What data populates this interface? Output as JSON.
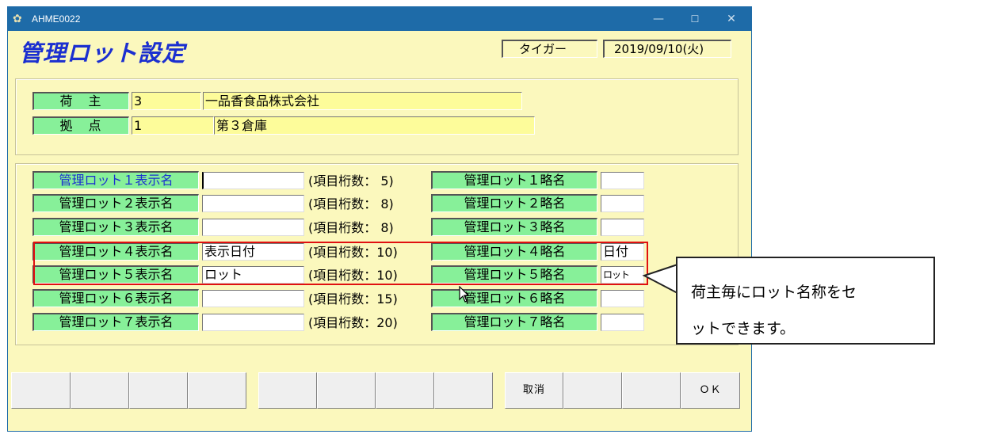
{
  "window": {
    "title": "AHME0022",
    "icon": "app-icon",
    "controls": {
      "minimize": "—",
      "maximize": "☐",
      "close": "✕"
    }
  },
  "header": {
    "page_title": "管理ロット設定",
    "user": "タイガー",
    "date": "2019/09/10(火)"
  },
  "shipper": {
    "label": "荷　主",
    "code": "3",
    "name": "一品香食品株式会社"
  },
  "base": {
    "label": "拠　点",
    "code": "1",
    "name": "第３倉庫"
  },
  "lots": [
    {
      "display_label": "管理ロット１表示名",
      "display_value": "",
      "digits": "(項目桁数： 5)",
      "short_label": "管理ロット１略名",
      "short_value": ""
    },
    {
      "display_label": "管理ロット２表示名",
      "display_value": "",
      "digits": "(項目桁数： 8)",
      "short_label": "管理ロット２略名",
      "short_value": ""
    },
    {
      "display_label": "管理ロット３表示名",
      "display_value": "",
      "digits": "(項目桁数： 8)",
      "short_label": "管理ロット３略名",
      "short_value": ""
    },
    {
      "display_label": "管理ロット４表示名",
      "display_value": "表示日付",
      "digits": "(項目桁数：10)",
      "short_label": "管理ロット４略名",
      "short_value": "日付"
    },
    {
      "display_label": "管理ロット５表示名",
      "display_value": "ロット",
      "digits": "(項目桁数：10)",
      "short_label": "管理ロット５略名",
      "short_value": "ロット"
    },
    {
      "display_label": "管理ロット６表示名",
      "display_value": "",
      "digits": "(項目桁数：15)",
      "short_label": "管理ロット６略名",
      "short_value": ""
    },
    {
      "display_label": "管理ロット７表示名",
      "display_value": "",
      "digits": "(項目桁数：20)",
      "short_label": "管理ロット７略名",
      "short_value": ""
    }
  ],
  "function_keys": [
    "",
    "",
    "",
    "",
    "",
    "",
    "",
    "",
    "取消",
    "",
    "",
    "ＯＫ"
  ],
  "callout": {
    "line1": "荷主毎にロット名称をセ",
    "line2": "ットできます。"
  },
  "colors": {
    "titlebar": "#1e6ba8",
    "window_bg": "#fbf8bd",
    "label_green": "#87f099",
    "field_yellow": "#fdfc9a",
    "title_blue": "#1b2fd0",
    "highlight_red": "#e01010"
  }
}
